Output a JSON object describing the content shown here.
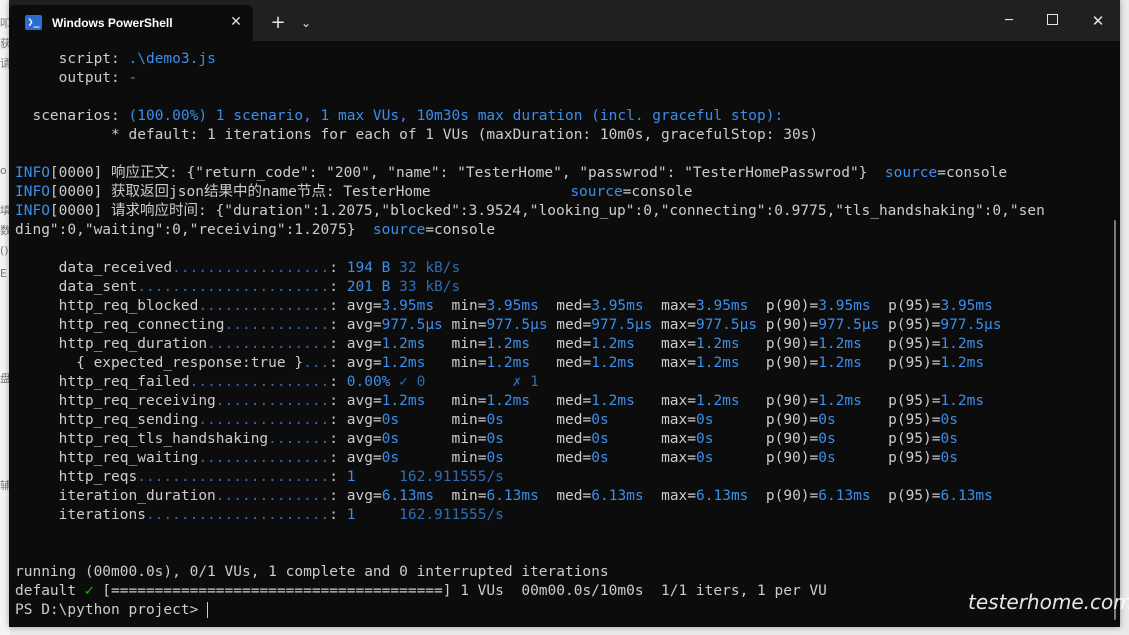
{
  "window": {
    "tab_title": "Windows PowerShell",
    "tab_icon_glyph": "❯_",
    "new_tab_glyph": "+",
    "dropdown_glyph": "⌄",
    "close_tab_glyph": "✕",
    "minimize_glyph": "─",
    "close_glyph": "✕",
    "accent_color": "#2a6dd1"
  },
  "background_chars": [
    "叩",
    "获",
    "请",
    "o",
    "填",
    "数",
    "()",
    "E",
    "盘",
    "辅"
  ],
  "terminal": {
    "lines": [
      [
        {
          "t": "     script: "
        },
        {
          "t": ".\\demo3.js",
          "c": "blue"
        }
      ],
      [
        {
          "t": "     output: "
        },
        {
          "t": "-",
          "c": "blue"
        }
      ],
      [
        {
          "t": ""
        }
      ],
      [
        {
          "t": "  scenarios: "
        },
        {
          "t": "(100.00%) 1 scenario, 1 max VUs, 10m30s max duration (incl. graceful stop):",
          "c": "blue"
        }
      ],
      [
        {
          "t": "           * default: 1 iterations for each of 1 VUs (maxDuration: 10m0s, gracefulStop: 30s)"
        }
      ],
      [
        {
          "t": ""
        }
      ],
      [
        {
          "t": "INFO",
          "c": "blue"
        },
        {
          "t": "[0000] 响应正文: {\"return_code\": \"200\", \"name\": \"TesterHome\", \"passwrod\": \"TesterHomePasswrod\"}  "
        },
        {
          "t": "source",
          "c": "blue"
        },
        {
          "t": "=console"
        }
      ],
      [
        {
          "t": "INFO",
          "c": "blue"
        },
        {
          "t": "[0000] 获取返回json结果中的name节点: TesterHome                "
        },
        {
          "t": "source",
          "c": "blue"
        },
        {
          "t": "=console"
        }
      ],
      [
        {
          "t": "INFO",
          "c": "blue"
        },
        {
          "t": "[0000] 请求响应时间: {\"duration\":1.2075,\"blocked\":3.9524,\"looking_up\":0,\"connecting\":0.9775,\"tls_handshaking\":0,\"sen"
        }
      ],
      [
        {
          "t": "ding\":0,\"waiting\":0,\"receiving\":1.2075}  "
        },
        {
          "t": "source",
          "c": "blue"
        },
        {
          "t": "=console"
        }
      ],
      [
        {
          "t": ""
        }
      ],
      [
        {
          "t": "     data_received"
        },
        {
          "t": "..................",
          "c": "dim"
        },
        {
          "t": ": "
        },
        {
          "t": "194 B",
          "c": "blue"
        },
        {
          "t": " "
        },
        {
          "t": "32 kB/s",
          "c": "dim"
        }
      ],
      [
        {
          "t": "     data_sent"
        },
        {
          "t": "......................",
          "c": "dim"
        },
        {
          "t": ": "
        },
        {
          "t": "201 B",
          "c": "blue"
        },
        {
          "t": " "
        },
        {
          "t": "33 kB/s",
          "c": "dim"
        }
      ],
      [
        {
          "t": "     http_req_blocked"
        },
        {
          "t": "...............",
          "c": "dim"
        },
        {
          "t": ": avg="
        },
        {
          "t": "3.95ms",
          "c": "blue"
        },
        {
          "t": "  min="
        },
        {
          "t": "3.95ms",
          "c": "blue"
        },
        {
          "t": "  med="
        },
        {
          "t": "3.95ms",
          "c": "blue"
        },
        {
          "t": "  max="
        },
        {
          "t": "3.95ms",
          "c": "blue"
        },
        {
          "t": "  p(90)="
        },
        {
          "t": "3.95ms",
          "c": "blue"
        },
        {
          "t": "  p(95)="
        },
        {
          "t": "3.95ms",
          "c": "blue"
        }
      ],
      [
        {
          "t": "     http_req_connecting"
        },
        {
          "t": "............",
          "c": "dim"
        },
        {
          "t": ": avg="
        },
        {
          "t": "977.5µs",
          "c": "blue"
        },
        {
          "t": " min="
        },
        {
          "t": "977.5µs",
          "c": "blue"
        },
        {
          "t": " med="
        },
        {
          "t": "977.5µs",
          "c": "blue"
        },
        {
          "t": " max="
        },
        {
          "t": "977.5µs",
          "c": "blue"
        },
        {
          "t": " p(90)="
        },
        {
          "t": "977.5µs",
          "c": "blue"
        },
        {
          "t": " p(95)="
        },
        {
          "t": "977.5µs",
          "c": "blue"
        }
      ],
      [
        {
          "t": "     http_req_duration"
        },
        {
          "t": "..............",
          "c": "dim"
        },
        {
          "t": ": avg="
        },
        {
          "t": "1.2ms",
          "c": "blue"
        },
        {
          "t": "   min="
        },
        {
          "t": "1.2ms",
          "c": "blue"
        },
        {
          "t": "   med="
        },
        {
          "t": "1.2ms",
          "c": "blue"
        },
        {
          "t": "   max="
        },
        {
          "t": "1.2ms",
          "c": "blue"
        },
        {
          "t": "   p(90)="
        },
        {
          "t": "1.2ms",
          "c": "blue"
        },
        {
          "t": "   p(95)="
        },
        {
          "t": "1.2ms",
          "c": "blue"
        }
      ],
      [
        {
          "t": "       { expected_response:true }"
        },
        {
          "t": "...",
          "c": "dim"
        },
        {
          "t": ": avg="
        },
        {
          "t": "1.2ms",
          "c": "blue"
        },
        {
          "t": "   min="
        },
        {
          "t": "1.2ms",
          "c": "blue"
        },
        {
          "t": "   med="
        },
        {
          "t": "1.2ms",
          "c": "blue"
        },
        {
          "t": "   max="
        },
        {
          "t": "1.2ms",
          "c": "blue"
        },
        {
          "t": "   p(90)="
        },
        {
          "t": "1.2ms",
          "c": "blue"
        },
        {
          "t": "   p(95)="
        },
        {
          "t": "1.2ms",
          "c": "blue"
        }
      ],
      [
        {
          "t": "     http_req_failed"
        },
        {
          "t": "................",
          "c": "dim"
        },
        {
          "t": ": "
        },
        {
          "t": "0.00%",
          "c": "blue"
        },
        {
          "t": " "
        },
        {
          "t": "✓ 0",
          "c": "dim"
        },
        {
          "t": "          "
        },
        {
          "t": "✗ 1",
          "c": "dim"
        }
      ],
      [
        {
          "t": "     http_req_receiving"
        },
        {
          "t": ".............",
          "c": "dim"
        },
        {
          "t": ": avg="
        },
        {
          "t": "1.2ms",
          "c": "blue"
        },
        {
          "t": "   min="
        },
        {
          "t": "1.2ms",
          "c": "blue"
        },
        {
          "t": "   med="
        },
        {
          "t": "1.2ms",
          "c": "blue"
        },
        {
          "t": "   max="
        },
        {
          "t": "1.2ms",
          "c": "blue"
        },
        {
          "t": "   p(90)="
        },
        {
          "t": "1.2ms",
          "c": "blue"
        },
        {
          "t": "   p(95)="
        },
        {
          "t": "1.2ms",
          "c": "blue"
        }
      ],
      [
        {
          "t": "     http_req_sending"
        },
        {
          "t": "...............",
          "c": "dim"
        },
        {
          "t": ": avg="
        },
        {
          "t": "0s",
          "c": "blue"
        },
        {
          "t": "      min="
        },
        {
          "t": "0s",
          "c": "blue"
        },
        {
          "t": "      med="
        },
        {
          "t": "0s",
          "c": "blue"
        },
        {
          "t": "      max="
        },
        {
          "t": "0s",
          "c": "blue"
        },
        {
          "t": "      p(90)="
        },
        {
          "t": "0s",
          "c": "blue"
        },
        {
          "t": "      p(95)="
        },
        {
          "t": "0s",
          "c": "blue"
        }
      ],
      [
        {
          "t": "     http_req_tls_handshaking"
        },
        {
          "t": ".......",
          "c": "dim"
        },
        {
          "t": ": avg="
        },
        {
          "t": "0s",
          "c": "blue"
        },
        {
          "t": "      min="
        },
        {
          "t": "0s",
          "c": "blue"
        },
        {
          "t": "      med="
        },
        {
          "t": "0s",
          "c": "blue"
        },
        {
          "t": "      max="
        },
        {
          "t": "0s",
          "c": "blue"
        },
        {
          "t": "      p(90)="
        },
        {
          "t": "0s",
          "c": "blue"
        },
        {
          "t": "      p(95)="
        },
        {
          "t": "0s",
          "c": "blue"
        }
      ],
      [
        {
          "t": "     http_req_waiting"
        },
        {
          "t": "...............",
          "c": "dim"
        },
        {
          "t": ": avg="
        },
        {
          "t": "0s",
          "c": "blue"
        },
        {
          "t": "      min="
        },
        {
          "t": "0s",
          "c": "blue"
        },
        {
          "t": "      med="
        },
        {
          "t": "0s",
          "c": "blue"
        },
        {
          "t": "      max="
        },
        {
          "t": "0s",
          "c": "blue"
        },
        {
          "t": "      p(90)="
        },
        {
          "t": "0s",
          "c": "blue"
        },
        {
          "t": "      p(95)="
        },
        {
          "t": "0s",
          "c": "blue"
        }
      ],
      [
        {
          "t": "     http_reqs"
        },
        {
          "t": "......................",
          "c": "dim"
        },
        {
          "t": ": "
        },
        {
          "t": "1",
          "c": "blue"
        },
        {
          "t": "     "
        },
        {
          "t": "162.911555/s",
          "c": "dim"
        }
      ],
      [
        {
          "t": "     iteration_duration"
        },
        {
          "t": ".............",
          "c": "dim"
        },
        {
          "t": ": avg="
        },
        {
          "t": "6.13ms",
          "c": "blue"
        },
        {
          "t": "  min="
        },
        {
          "t": "6.13ms",
          "c": "blue"
        },
        {
          "t": "  med="
        },
        {
          "t": "6.13ms",
          "c": "blue"
        },
        {
          "t": "  max="
        },
        {
          "t": "6.13ms",
          "c": "blue"
        },
        {
          "t": "  p(90)="
        },
        {
          "t": "6.13ms",
          "c": "blue"
        },
        {
          "t": "  p(95)="
        },
        {
          "t": "6.13ms",
          "c": "blue"
        }
      ],
      [
        {
          "t": "     iterations"
        },
        {
          "t": ".....................",
          "c": "dim"
        },
        {
          "t": ": "
        },
        {
          "t": "1",
          "c": "blue"
        },
        {
          "t": "     "
        },
        {
          "t": "162.911555/s",
          "c": "dim"
        }
      ],
      [
        {
          "t": ""
        }
      ],
      [
        {
          "t": ""
        }
      ],
      [
        {
          "t": "running (00m00.0s), 0/1 VUs, 1 complete and 0 interrupted iterations"
        }
      ],
      [
        {
          "t": "default "
        },
        {
          "t": "✓",
          "c": "green"
        },
        {
          "t": " [======================================] 1 VUs  00m00.0s/10m0s  1/1 iters, 1 per VU"
        }
      ],
      [
        {
          "t": "PS D:\\python project> "
        }
      ]
    ]
  },
  "watermark": "testerhome.com"
}
